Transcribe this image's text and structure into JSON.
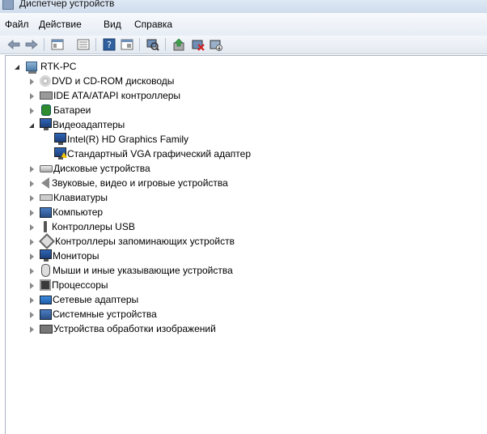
{
  "window": {
    "title": "Диспетчер устройств"
  },
  "menu": [
    {
      "label": "Файл"
    },
    {
      "label": "Действие"
    },
    {
      "label": "Вид"
    },
    {
      "label": "Справка"
    }
  ],
  "toolbar": [
    {
      "icon": "back-arrow-icon"
    },
    {
      "icon": "forward-arrow-icon"
    },
    {
      "icon": "properties-icon"
    },
    {
      "icon": "list-icon"
    },
    {
      "icon": "help-icon"
    },
    {
      "icon": "view-icon"
    },
    {
      "icon": "scan-hardware-icon"
    },
    {
      "icon": "update-driver-icon"
    },
    {
      "icon": "disable-device-icon"
    },
    {
      "icon": "uninstall-device-icon"
    }
  ],
  "tree": {
    "root": "RTK-PC",
    "categories": [
      {
        "label": "DVD и CD-ROM дисководы",
        "icon": "disc-drive-icon"
      },
      {
        "label": "IDE ATA/ATAPI контроллеры",
        "icon": "ide-controller-icon"
      },
      {
        "label": "Батареи",
        "icon": "battery-icon"
      },
      {
        "label": "Видеоадаптеры",
        "icon": "display-adapter-icon",
        "expanded": true,
        "children": [
          {
            "label": "Intel(R) HD Graphics Family",
            "icon": "display-adapter-icon"
          },
          {
            "label": "Стандартный VGA графический адаптер",
            "icon": "display-adapter-warning-icon"
          }
        ]
      },
      {
        "label": "Дисковые устройства",
        "icon": "disk-drive-icon"
      },
      {
        "label": "Звуковые, видео и игровые устройства",
        "icon": "speaker-icon"
      },
      {
        "label": "Клавиатуры",
        "icon": "keyboard-icon"
      },
      {
        "label": "Компьютер",
        "icon": "computer-icon"
      },
      {
        "label": "Контроллеры USB",
        "icon": "usb-icon"
      },
      {
        "label": "Контроллеры запоминающих устройств",
        "icon": "storage-controller-icon"
      },
      {
        "label": "Мониторы",
        "icon": "monitor-icon"
      },
      {
        "label": "Мыши и иные указывающие устройства",
        "icon": "mouse-icon"
      },
      {
        "label": "Процессоры",
        "icon": "processor-icon"
      },
      {
        "label": "Сетевые адаптеры",
        "icon": "network-adapter-icon"
      },
      {
        "label": "Системные устройства",
        "icon": "system-devices-icon"
      },
      {
        "label": "Устройства обработки изображений",
        "icon": "imaging-device-icon"
      }
    ]
  }
}
